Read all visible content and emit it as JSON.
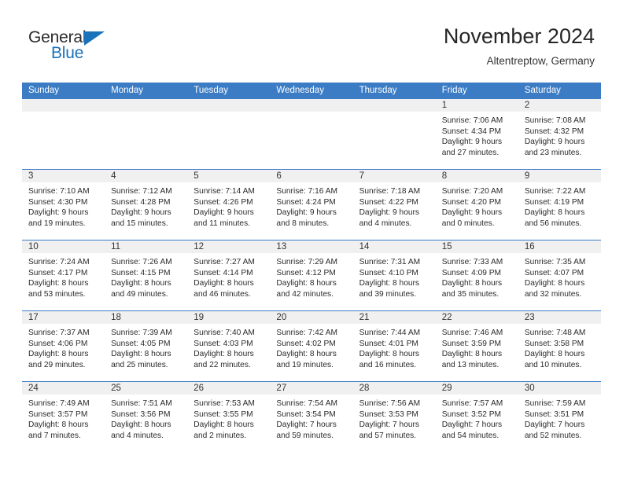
{
  "brand": {
    "name_part1": "General",
    "name_part2": "Blue",
    "accent_color": "#1a72bb"
  },
  "header": {
    "title": "November 2024",
    "subtitle": "Altentreptow, Germany"
  },
  "calendar": {
    "header_color": "#3b7cc4",
    "weekdays": [
      "Sunday",
      "Monday",
      "Tuesday",
      "Wednesday",
      "Thursday",
      "Friday",
      "Saturday"
    ],
    "weeks": [
      [
        {
          "day": "",
          "empty": true,
          "lines": []
        },
        {
          "day": "",
          "empty": true,
          "lines": []
        },
        {
          "day": "",
          "empty": true,
          "lines": []
        },
        {
          "day": "",
          "empty": true,
          "lines": []
        },
        {
          "day": "",
          "empty": true,
          "lines": []
        },
        {
          "day": "1",
          "empty": false,
          "lines": [
            "Sunrise: 7:06 AM",
            "Sunset: 4:34 PM",
            "Daylight: 9 hours",
            "and 27 minutes."
          ]
        },
        {
          "day": "2",
          "empty": false,
          "lines": [
            "Sunrise: 7:08 AM",
            "Sunset: 4:32 PM",
            "Daylight: 9 hours",
            "and 23 minutes."
          ]
        }
      ],
      [
        {
          "day": "3",
          "empty": false,
          "lines": [
            "Sunrise: 7:10 AM",
            "Sunset: 4:30 PM",
            "Daylight: 9 hours",
            "and 19 minutes."
          ]
        },
        {
          "day": "4",
          "empty": false,
          "lines": [
            "Sunrise: 7:12 AM",
            "Sunset: 4:28 PM",
            "Daylight: 9 hours",
            "and 15 minutes."
          ]
        },
        {
          "day": "5",
          "empty": false,
          "lines": [
            "Sunrise: 7:14 AM",
            "Sunset: 4:26 PM",
            "Daylight: 9 hours",
            "and 11 minutes."
          ]
        },
        {
          "day": "6",
          "empty": false,
          "lines": [
            "Sunrise: 7:16 AM",
            "Sunset: 4:24 PM",
            "Daylight: 9 hours",
            "and 8 minutes."
          ]
        },
        {
          "day": "7",
          "empty": false,
          "lines": [
            "Sunrise: 7:18 AM",
            "Sunset: 4:22 PM",
            "Daylight: 9 hours",
            "and 4 minutes."
          ]
        },
        {
          "day": "8",
          "empty": false,
          "lines": [
            "Sunrise: 7:20 AM",
            "Sunset: 4:20 PM",
            "Daylight: 9 hours",
            "and 0 minutes."
          ]
        },
        {
          "day": "9",
          "empty": false,
          "lines": [
            "Sunrise: 7:22 AM",
            "Sunset: 4:19 PM",
            "Daylight: 8 hours",
            "and 56 minutes."
          ]
        }
      ],
      [
        {
          "day": "10",
          "empty": false,
          "lines": [
            "Sunrise: 7:24 AM",
            "Sunset: 4:17 PM",
            "Daylight: 8 hours",
            "and 53 minutes."
          ]
        },
        {
          "day": "11",
          "empty": false,
          "lines": [
            "Sunrise: 7:26 AM",
            "Sunset: 4:15 PM",
            "Daylight: 8 hours",
            "and 49 minutes."
          ]
        },
        {
          "day": "12",
          "empty": false,
          "lines": [
            "Sunrise: 7:27 AM",
            "Sunset: 4:14 PM",
            "Daylight: 8 hours",
            "and 46 minutes."
          ]
        },
        {
          "day": "13",
          "empty": false,
          "lines": [
            "Sunrise: 7:29 AM",
            "Sunset: 4:12 PM",
            "Daylight: 8 hours",
            "and 42 minutes."
          ]
        },
        {
          "day": "14",
          "empty": false,
          "lines": [
            "Sunrise: 7:31 AM",
            "Sunset: 4:10 PM",
            "Daylight: 8 hours",
            "and 39 minutes."
          ]
        },
        {
          "day": "15",
          "empty": false,
          "lines": [
            "Sunrise: 7:33 AM",
            "Sunset: 4:09 PM",
            "Daylight: 8 hours",
            "and 35 minutes."
          ]
        },
        {
          "day": "16",
          "empty": false,
          "lines": [
            "Sunrise: 7:35 AM",
            "Sunset: 4:07 PM",
            "Daylight: 8 hours",
            "and 32 minutes."
          ]
        }
      ],
      [
        {
          "day": "17",
          "empty": false,
          "lines": [
            "Sunrise: 7:37 AM",
            "Sunset: 4:06 PM",
            "Daylight: 8 hours",
            "and 29 minutes."
          ]
        },
        {
          "day": "18",
          "empty": false,
          "lines": [
            "Sunrise: 7:39 AM",
            "Sunset: 4:05 PM",
            "Daylight: 8 hours",
            "and 25 minutes."
          ]
        },
        {
          "day": "19",
          "empty": false,
          "lines": [
            "Sunrise: 7:40 AM",
            "Sunset: 4:03 PM",
            "Daylight: 8 hours",
            "and 22 minutes."
          ]
        },
        {
          "day": "20",
          "empty": false,
          "lines": [
            "Sunrise: 7:42 AM",
            "Sunset: 4:02 PM",
            "Daylight: 8 hours",
            "and 19 minutes."
          ]
        },
        {
          "day": "21",
          "empty": false,
          "lines": [
            "Sunrise: 7:44 AM",
            "Sunset: 4:01 PM",
            "Daylight: 8 hours",
            "and 16 minutes."
          ]
        },
        {
          "day": "22",
          "empty": false,
          "lines": [
            "Sunrise: 7:46 AM",
            "Sunset: 3:59 PM",
            "Daylight: 8 hours",
            "and 13 minutes."
          ]
        },
        {
          "day": "23",
          "empty": false,
          "lines": [
            "Sunrise: 7:48 AM",
            "Sunset: 3:58 PM",
            "Daylight: 8 hours",
            "and 10 minutes."
          ]
        }
      ],
      [
        {
          "day": "24",
          "empty": false,
          "lines": [
            "Sunrise: 7:49 AM",
            "Sunset: 3:57 PM",
            "Daylight: 8 hours",
            "and 7 minutes."
          ]
        },
        {
          "day": "25",
          "empty": false,
          "lines": [
            "Sunrise: 7:51 AM",
            "Sunset: 3:56 PM",
            "Daylight: 8 hours",
            "and 4 minutes."
          ]
        },
        {
          "day": "26",
          "empty": false,
          "lines": [
            "Sunrise: 7:53 AM",
            "Sunset: 3:55 PM",
            "Daylight: 8 hours",
            "and 2 minutes."
          ]
        },
        {
          "day": "27",
          "empty": false,
          "lines": [
            "Sunrise: 7:54 AM",
            "Sunset: 3:54 PM",
            "Daylight: 7 hours",
            "and 59 minutes."
          ]
        },
        {
          "day": "28",
          "empty": false,
          "lines": [
            "Sunrise: 7:56 AM",
            "Sunset: 3:53 PM",
            "Daylight: 7 hours",
            "and 57 minutes."
          ]
        },
        {
          "day": "29",
          "empty": false,
          "lines": [
            "Sunrise: 7:57 AM",
            "Sunset: 3:52 PM",
            "Daylight: 7 hours",
            "and 54 minutes."
          ]
        },
        {
          "day": "30",
          "empty": false,
          "lines": [
            "Sunrise: 7:59 AM",
            "Sunset: 3:51 PM",
            "Daylight: 7 hours",
            "and 52 minutes."
          ]
        }
      ]
    ]
  }
}
